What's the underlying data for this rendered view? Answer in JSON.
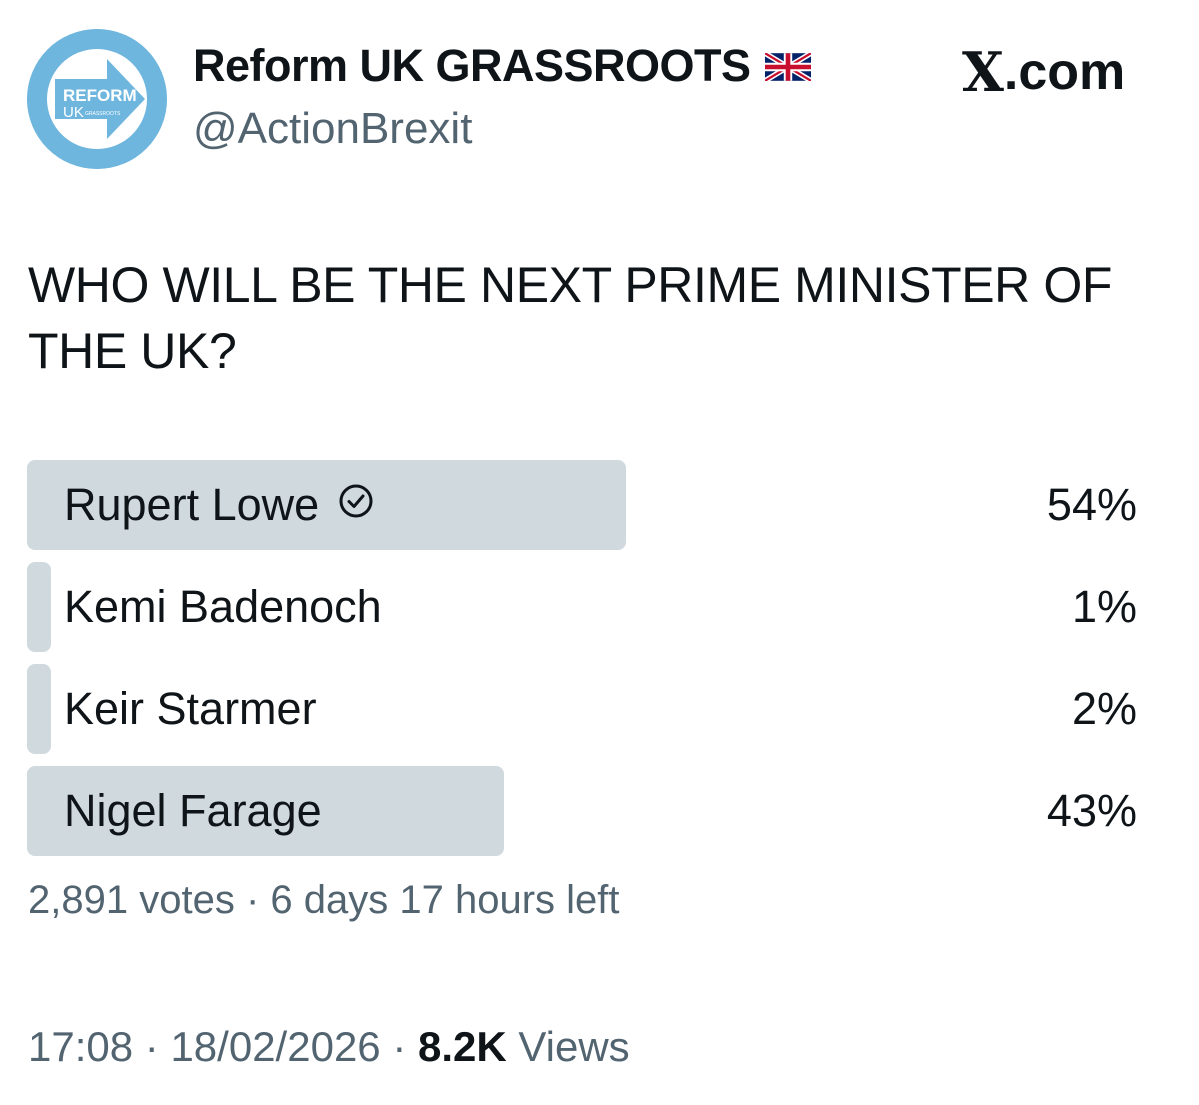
{
  "header": {
    "display_name": "Reform UK GRASSROOTS",
    "handle": "@ActionBrexit",
    "flag_icon": "uk-flag-icon",
    "source": ".com",
    "source_logo": "X",
    "avatar_logo": {
      "line1": "REFORM",
      "line2": "UK",
      "line3": "GRASSROOTS"
    }
  },
  "post": {
    "question": "WHO WILL BE THE NEXT PRIME MINISTER OF THE UK?"
  },
  "poll": {
    "options": [
      {
        "label": "Rupert Lowe",
        "percent_label": "54%",
        "percent": 54,
        "selected": true
      },
      {
        "label": "Kemi Badenoch",
        "percent_label": "1%",
        "percent": 1,
        "selected": false
      },
      {
        "label": "Keir Starmer",
        "percent_label": "2%",
        "percent": 2,
        "selected": false
      },
      {
        "label": "Nigel Farage",
        "percent_label": "43%",
        "percent": 43,
        "selected": false
      }
    ],
    "votes": "2,891 votes",
    "separator": "·",
    "time_left": "6 days 17 hours left"
  },
  "footer": {
    "time": "17:08",
    "date": "18/02/2026",
    "separator": "·",
    "views_count": "8.2K",
    "views_label": "Views"
  },
  "colors": {
    "bar": "#cfd9de",
    "muted_text": "#536471",
    "text": "#0f1419",
    "avatar_blue": "#6fb6df"
  }
}
